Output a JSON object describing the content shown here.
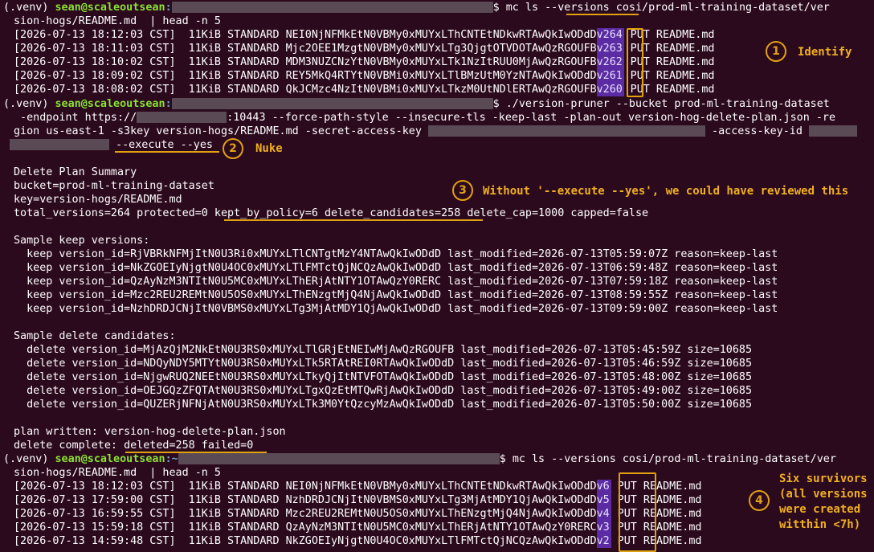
{
  "prompt": {
    "venv": "(.venv) ",
    "user_host": "sean@scaleoutsean",
    "colon": ":",
    "dollar": "$ "
  },
  "commands": {
    "cmd1_a": "mc ls ",
    "cmd1_flag": "--versions",
    "cmd1_b": " cosi/prod-ml-training-dataset/ver",
    "cmd1_c": "sion-hogs/README.md  | head -n 5",
    "cmd2_a": "./version-pruner --bucket prod-ml-training-dataset",
    "cmd2_b": " -endpoint https://",
    "cmd2_c": ":10443 --force-path-style --insecure-tls -keep-last -plan-out version-hog-delete-plan.json -re",
    "cmd2_d": "gion us-east-1 -s3key version-hogs/README.md -secret-access-key ",
    "cmd2_e": " -access-key-id ",
    "cmd2_f": "--execute --yes",
    "cmd3_a": "mc ls --versions cosi/prod-ml-training-dataset/ver",
    "cmd3_b": "sion-hogs/README.md  | head -n 5"
  },
  "listing1": [
    {
      "date": "[2026-07-13 18:12:03 CST]",
      "size": "11KiB",
      "class": "STANDARD",
      "id": "NEI0NjNFMkEtN0VBMy0xMUYxLThCNTEtNDkwRTAwQkIwODdD",
      "ver": "v264",
      "tail": "PUT README.md"
    },
    {
      "date": "[2026-07-13 18:11:03 CST]",
      "size": "11KiB",
      "class": "STANDARD",
      "id": "Mjc2OEE1MzgtN0VBMy0xMUYxLTg3QjgtOTVDOTAwQzRGOUFB",
      "ver": "v263",
      "tail": "PUT README.md"
    },
    {
      "date": "[2026-07-13 18:10:02 CST]",
      "size": "11KiB",
      "class": "STANDARD",
      "id": "MDM3NUZCNzYtN0VBMy0xMUYxLTk1NzItRUU0MjAwQzRGOUFB",
      "ver": "v262",
      "tail": "PUT README.md"
    },
    {
      "date": "[2026-07-13 18:09:02 CST]",
      "size": "11KiB",
      "class": "STANDARD",
      "id": "REY5MkQ4RTYtN0VBMi0xMUYxLTlBMzUtM0YzNTAwQkIwODdD",
      "ver": "v261",
      "tail": "PUT README.md"
    },
    {
      "date": "[2026-07-13 18:08:02 CST]",
      "size": "11KiB",
      "class": "STANDARD",
      "id": "QkJCMzc4NzItN0VBMi0xMUYxLTkzM0UtNDlERTAwQzRGOUFB",
      "ver": "v260",
      "tail": "PUT README.md"
    }
  ],
  "summary": {
    "title": "Delete Plan Summary",
    "bucket": "bucket=prod-ml-training-dataset",
    "key": "key=version-hogs/README.md",
    "totals_a": "total_versions=264 protected=0 ",
    "totals_kept": "kept_by_policy=6 delete_candidates=258",
    "totals_b": " delete_cap=1000 capped=false"
  },
  "keep_header": "Sample keep versions:",
  "keep": [
    "  keep version_id=RjVBRkNFMjItN0U3Ri0xMUYxLTlCNTgtMzY4NTAwQkIwODdD last_modified=2026-07-13T05:59:07Z reason=keep-last",
    "  keep version_id=NkZGOEIyNjgtN0U4OC0xMUYxLTlFMTctQjNCQzAwQkIwODdD last_modified=2026-07-13T06:59:48Z reason=keep-last",
    "  keep version_id=QzAyNzM3NTItN0U5MC0xMUYxLThERjAtNTY1OTAwQzY0RERC last_modified=2026-07-13T07:59:18Z reason=keep-last",
    "  keep version_id=Mzc2REU2REMtN0U5OS0xMUYxLThENzgtMjQ4NjAwQkIwODdD last_modified=2026-07-13T08:59:55Z reason=keep-last",
    "  keep version_id=NzhDRDJCNjItN0VBMS0xMUYxLTg3MjAtMDY1QjAwQkIwODdD last_modified=2026-07-13T09:59:00Z reason=keep-last"
  ],
  "delete_header": "Sample delete candidates:",
  "delete": [
    "  delete version_id=MjAzQjM2NkEtN0U3RS0xMUYxLTlGRjEtNEIwMjAwQzRGOUFB last_modified=2026-07-13T05:45:59Z size=10685",
    "  delete version_id=NDQyNDY5MTYtN0U3RS0xMUYxLTk5RTAtREI0RTAwQkIwODdD last_modified=2026-07-13T05:46:59Z size=10685",
    "  delete version_id=NjgwRUQ2NEEtN0U3RS0xMUYxLTkyQjItNTVFOTAwQkIwODdD last_modified=2026-07-13T05:48:00Z size=10685",
    "  delete version_id=OEJGQzZFQTAtN0U3RS0xMUYxLTgxQzEtMTQwRjAwQkIwODdD last_modified=2026-07-13T05:49:00Z size=10685",
    "  delete version_id=QUZERjNFNjAtN0U3RS0xMUYxLTk3M0YtQzcyMzAwQkIwODdD last_modified=2026-07-13T05:50:00Z size=10685"
  ],
  "plan_written": "plan written: version-hog-delete-plan.json",
  "delete_complete_a": "delete complete: ",
  "delete_complete_b": "deleted=258 failed=0",
  "listing2": [
    {
      "date": "[2026-07-13 18:12:03 CST]",
      "size": "11KiB",
      "class": "STANDARD",
      "id": "NEI0NjNFMkEtN0VBMy0xMUYxLThCNTEtNDkwRTAwQkIwODdD",
      "ver": "v6",
      "tail": "PUT README.md"
    },
    {
      "date": "[2026-07-13 17:59:00 CST]",
      "size": "11KiB",
      "class": "STANDARD",
      "id": "NzhDRDJCNjItN0VBMS0xMUYxLTg3MjAtMDY1QjAwQkIwODdD",
      "ver": "v5",
      "tail": "PUT README.md"
    },
    {
      "date": "[2026-07-13 16:59:55 CST]",
      "size": "11KiB",
      "class": "STANDARD",
      "id": "Mzc2REU2REMtN0U5OS0xMUYxLThENzgtMjQ4NjAwQkIwODdD",
      "ver": "v4",
      "tail": "PUT README.md"
    },
    {
      "date": "[2026-07-13 15:59:18 CST]",
      "size": "11KiB",
      "class": "STANDARD",
      "id": "QzAyNzM3NTItN0U5MC0xMUYxLThERjAtNTY1OTAwQzY0RERC",
      "ver": "v3",
      "tail": "PUT README.md"
    },
    {
      "date": "[2026-07-13 14:59:48 CST]",
      "size": "11KiB",
      "class": "STANDARD",
      "id": "NkZGOEIyNjgtN0U4OC0xMUYxLTlFMTctQjNCQzAwQkIwODdD",
      "ver": "v2",
      "tail": "PUT README.md"
    }
  ],
  "annotations": {
    "b1": "1",
    "n1": "Identify",
    "b2": "2",
    "n2": "Nuke",
    "b3": "3",
    "n3": "Without '--execute --yes', we could have reviewed this",
    "b4": "4",
    "n4_1": "Six survivors",
    "n4_2": "(all versions",
    "n4_3": "were created",
    "n4_4": "witthin <7h)"
  },
  "colors": {
    "background": "#2c0a1e",
    "prompt_user": "#8ae234",
    "accent": "#e0a110",
    "version_tag": "#5b2ba3"
  }
}
